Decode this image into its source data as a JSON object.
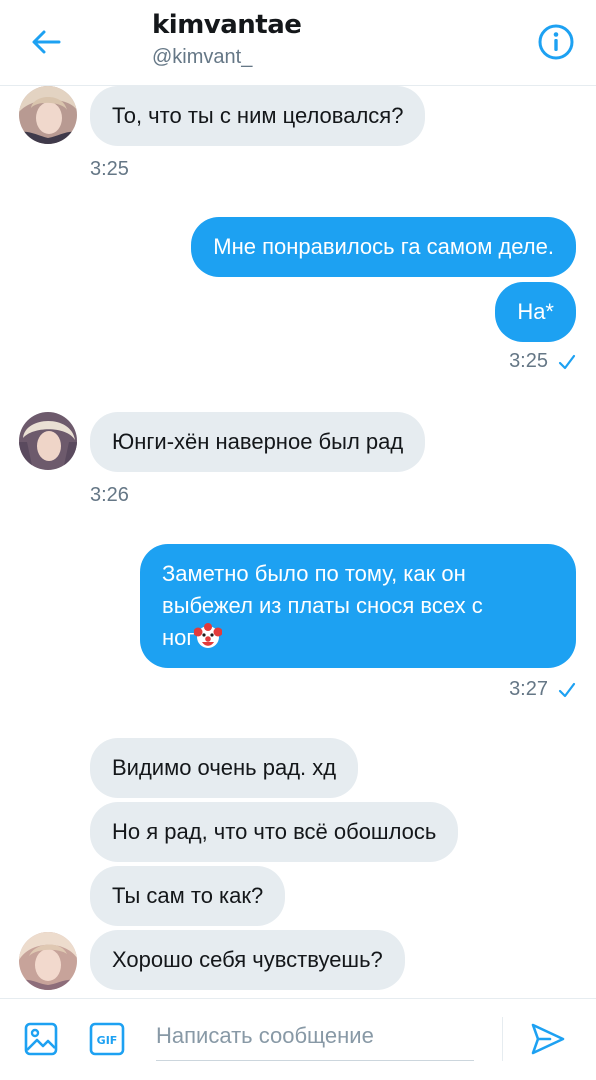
{
  "header": {
    "title": "kimvantae",
    "handle": "@kimvant_"
  },
  "colors": {
    "accent": "#1da1f2",
    "incoming_bubble": "#e6ecf0",
    "meta_text": "#657786"
  },
  "messages": [
    {
      "direction": "in",
      "text": "То, что ты с ним целовался?",
      "time": "3:25"
    },
    {
      "direction": "out",
      "text": "Мне понравилось га самом деле."
    },
    {
      "direction": "out",
      "text": "На*",
      "time": "3:25",
      "read": true
    },
    {
      "direction": "in",
      "text": "Юнги-хён наверное был рад",
      "time": "3:26"
    },
    {
      "direction": "out",
      "lines": [
        "Заметно было по тому, как он",
        "выбежел из платы снося всех с",
        "ног"
      ],
      "emoji": "clown-face",
      "time": "3:27",
      "read": true
    },
    {
      "direction": "in",
      "text": "Видимо очень рад. хд"
    },
    {
      "direction": "in",
      "text": "Но я рад, что что всё обошлось"
    },
    {
      "direction": "in",
      "text": "Ты сам то как?"
    },
    {
      "direction": "in",
      "text": "Хорошо себя чувствуешь?"
    }
  ],
  "composer": {
    "placeholder": "Написать сообщение",
    "gif_label": "GIF",
    "icons": [
      "image-icon",
      "gif-icon",
      "send-icon"
    ]
  }
}
